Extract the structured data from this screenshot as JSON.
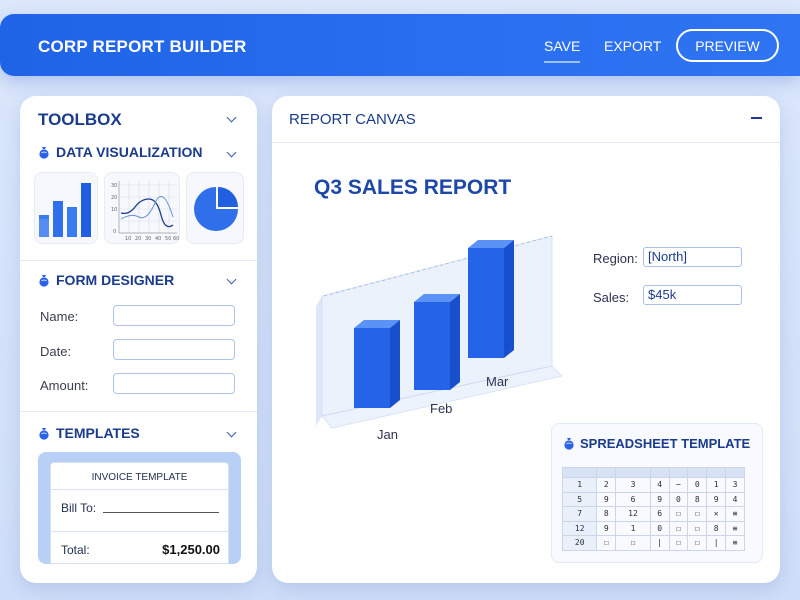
{
  "header": {
    "title": "CORP REPORT BUILDER",
    "nav": {
      "save": "SAVE",
      "export": "EXPORT",
      "preview": "PREVIEW"
    }
  },
  "toolbox": {
    "title": "TOOLBOX",
    "data_visualization": {
      "label": "DATA VISUALIZATION",
      "line_chart_y_ticks": [
        "30",
        "20",
        "10",
        "0"
      ],
      "line_chart_x_ticks": [
        "10",
        "20",
        "30",
        "40",
        "50",
        "60"
      ]
    },
    "form_designer": {
      "label": "FORM DESIGNER",
      "fields": [
        {
          "label": "Name:",
          "value": ""
        },
        {
          "label": "Date:",
          "value": ""
        },
        {
          "label": "Amount:",
          "value": ""
        }
      ]
    },
    "templates": {
      "label": "TEMPLATES",
      "invoice": {
        "title": "INVOICE TEMPLATE",
        "bill_to": "Bill To:",
        "total_label": "Total:",
        "total_value": "$1,250.00"
      }
    }
  },
  "canvas": {
    "title": "REPORT CANVAS",
    "report_title": "Q3 SALES REPORT",
    "region_label": "Region:",
    "region_value": "[North]",
    "sales_label": "Sales:",
    "sales_value": "$45k",
    "chart_months": [
      "Jan",
      "Feb",
      "Mar"
    ],
    "spreadsheet": {
      "title": "SPREADSHEET TEMPLATE",
      "rows": [
        [
          "1",
          "2",
          "3",
          "4",
          "−",
          "0",
          "1",
          "3"
        ],
        [
          "5",
          "9",
          "6",
          "9",
          "0",
          "8",
          "9",
          "4"
        ],
        [
          "7",
          "8",
          "12",
          "6",
          "☐",
          "☐",
          "✕",
          "≡"
        ],
        [
          "12",
          "9",
          "1",
          "0",
          "☐",
          "☐",
          "8",
          "≡"
        ],
        [
          "20",
          "☐",
          "☐",
          "|",
          "☐",
          "☐",
          "|",
          "≡"
        ]
      ]
    }
  },
  "colors": {
    "primary": "#1f63e6",
    "accent": "#2a62e8",
    "text_dark": "#1b3b8c"
  }
}
